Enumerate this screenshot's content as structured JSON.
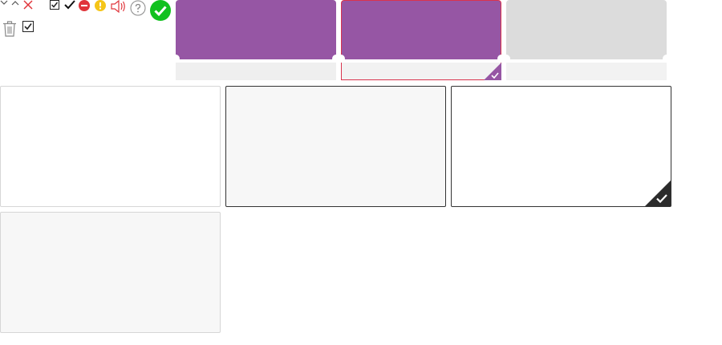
{
  "icons": [
    "chevron-down-icon",
    "chevron-up-icon",
    "close-icon",
    "checkbox-checked-icon",
    "checkmark-icon",
    "minus-circle-icon",
    "warning-circle-icon",
    "speaker-icon",
    "help-circle-icon",
    "success-check-circle-icon",
    "trash-icon",
    "checkbox-checked-icon"
  ],
  "colors": {
    "purple": "#9656a4",
    "disabled_gray": "#dcdcdc",
    "footer_gray": "#efefef",
    "selected_red": "#d9344e",
    "success_green": "#11c11f",
    "danger_red": "#e0353b",
    "warning_yellow": "#f5c518",
    "card_dark_border": "#333333",
    "card_light_border": "#d6d6d6",
    "card_gray_fill": "#f7f7f7"
  },
  "tickets": [
    {
      "state": "default"
    },
    {
      "state": "selected",
      "checked": true
    },
    {
      "state": "disabled"
    }
  ],
  "cards": [
    {
      "state": "default"
    },
    {
      "state": "hover"
    },
    {
      "state": "selected",
      "checked": true
    },
    {
      "state": "disabled"
    }
  ]
}
